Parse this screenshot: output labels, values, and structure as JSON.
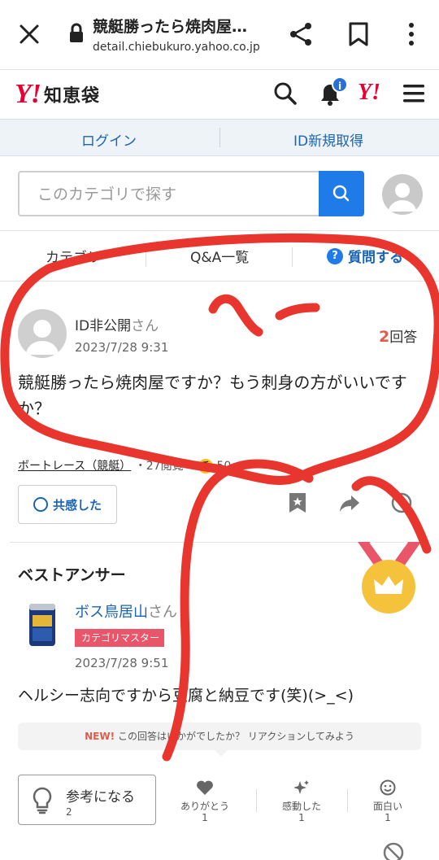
{
  "browser": {
    "title": "競艇勝ったら焼肉屋…",
    "url": "detail.chiebukuro.yahoo.co.jp"
  },
  "site": {
    "logo_mark": "Y!",
    "logo_text": "知恵袋",
    "notification_badge": "i",
    "y_mark": "Y!"
  },
  "auth": {
    "login": "ログイン",
    "register": "ID新規取得"
  },
  "search": {
    "placeholder": "このカテゴリで探す"
  },
  "tabs": {
    "category": "カテゴリ",
    "qa_list": "Q&A一覧",
    "ask": "質問する",
    "ask_icon": "?"
  },
  "question": {
    "user": "ID非公開",
    "user_suffix": "さん",
    "date": "2023/7/28 9:31",
    "answer_count": "2",
    "answer_label": "回答",
    "body": "競艇勝ったら焼肉屋ですか？もう刺身の方がいいですか？",
    "category": "ボートレース（競艇）",
    "views": "・27閲覧・",
    "coin_label": "チ",
    "coins": "50"
  },
  "actions": {
    "empathy": "共感した"
  },
  "best_answer": {
    "heading": "ベストアンサー",
    "user": "ボス鳥居山",
    "user_suffix": "さん",
    "badge": "カテゴリマスター",
    "date": "2023/7/28 9:51",
    "body": "ヘルシー志向ですから豆腐と納豆です(笑)(>_<)",
    "reaction_new": "NEW!",
    "reaction_prompt": "この回答はいかがでしたか？ リアクションしてみよう",
    "helpful_label": "参考になる",
    "helpful_count": "2",
    "reactions": [
      {
        "label": "ありがとう",
        "count": "1",
        "icon": "heart-icon"
      },
      {
        "label": "感動した",
        "count": "1",
        "icon": "sparkle-icon"
      },
      {
        "label": "面白い",
        "count": "1",
        "icon": "smile-icon"
      }
    ]
  },
  "colors": {
    "accent_blue": "#1e7be8",
    "link_blue": "#1a64b4",
    "brand_red": "#e60033",
    "scribble_red": "#e8362e"
  }
}
